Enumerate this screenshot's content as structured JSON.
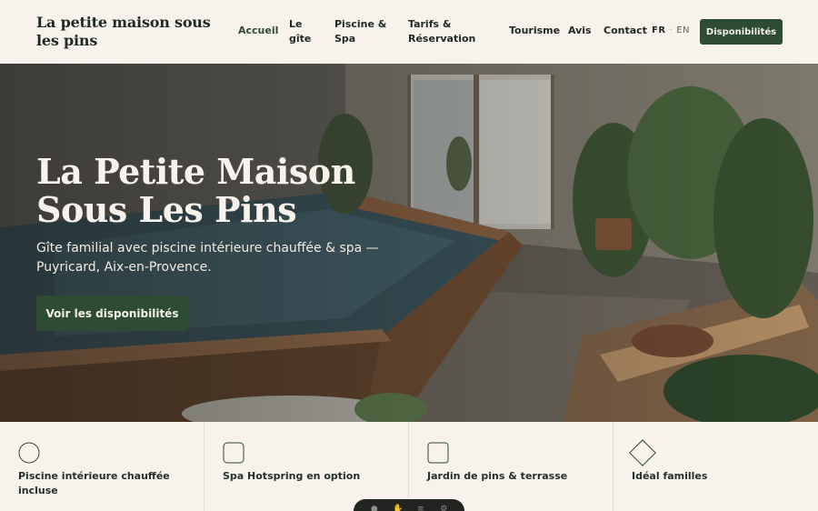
{
  "header": {
    "brand": "La petite maison sous les pins",
    "nav": [
      {
        "label": "Accueil"
      },
      {
        "label": "Le gîte"
      },
      {
        "label": "Piscine & Spa"
      },
      {
        "label": "Tarifs & Réservation"
      },
      {
        "label": "Tourisme"
      },
      {
        "label": "Avis"
      },
      {
        "label": "Contact"
      }
    ],
    "lang": {
      "fr": "FR",
      "sep": "·",
      "en": "EN"
    },
    "cta": "Disponibilités"
  },
  "hero": {
    "title": "La Petite Maison Sous Les Pins",
    "subtitle": "Gîte familial avec piscine intérieure chauffée & spa — Puyricard, Aix-en-Provence.",
    "cta": "Voir les disponibilités"
  },
  "features": [
    {
      "label": "Piscine intérieure chauffée incluse",
      "icon": "circle-icon"
    },
    {
      "label": "Spa Hotspring en option",
      "icon": "rounded-square-icon"
    },
    {
      "label": "Jardin de pins & terrasse",
      "icon": "rounded-square-icon"
    },
    {
      "label": "Idéal familles",
      "icon": "diamond-icon"
    }
  ],
  "colors": {
    "accent": "#2e4b34",
    "background": "#f7f3ec",
    "text": "#1f2a22"
  }
}
